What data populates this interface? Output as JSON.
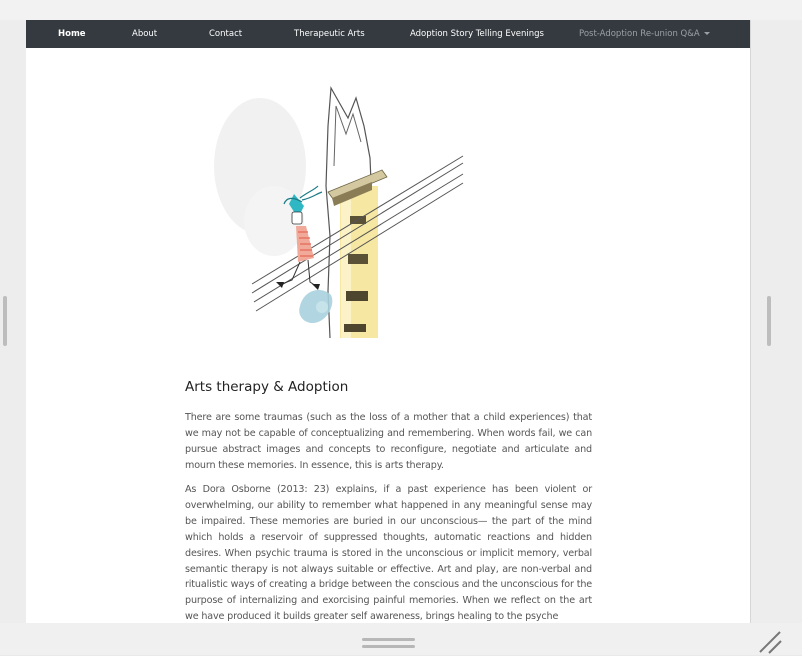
{
  "nav": {
    "items": [
      {
        "label": "Home"
      },
      {
        "label": "About"
      },
      {
        "label": "Contact"
      },
      {
        "label": "Therapeutic Arts"
      },
      {
        "label": "Adoption Story Telling Evenings"
      }
    ],
    "dropdown_label": "Post-Adoption Re-union Q&A"
  },
  "article": {
    "title": "Arts therapy & Adoption",
    "paragraphs": [
      "There are some traumas (such as the loss of a mother that a child experiences) that we may not be capable of conceptualizing and remembering. When words fail, we can pursue abstract images and concepts to reconfigure, negotiate and articulate and mourn these memories. In essence, this is arts therapy.",
      "As Dora Osborne (2013: 23) explains, if a past experience has been violent or overwhelming, our ability to remember what happened in any meaningful sense may be impaired. These memories are buried in our unconscious— the part of the mind which holds a reservoir of suppressed thoughts, automatic reactions and hidden desires. When psychic trauma is stored in the unconscious or implicit memory, verbal semantic therapy is not always suitable or effective. Art and play, are non-verbal and ritualistic ways of creating a bridge between the conscious and the unconscious for the purpose of internalizing and exorcising painful memories. When we reflect on the art we have produced it builds greater self awareness, brings healing to the psyche"
    ]
  },
  "colors": {
    "navbar": "#343a40",
    "nav_text": "#ffffff",
    "nav_dropdown_text": "#9aa0a6",
    "body_text": "#555555"
  },
  "icons": {
    "dropdown": "caret-down-icon",
    "resize": "resize-grip-icon"
  }
}
